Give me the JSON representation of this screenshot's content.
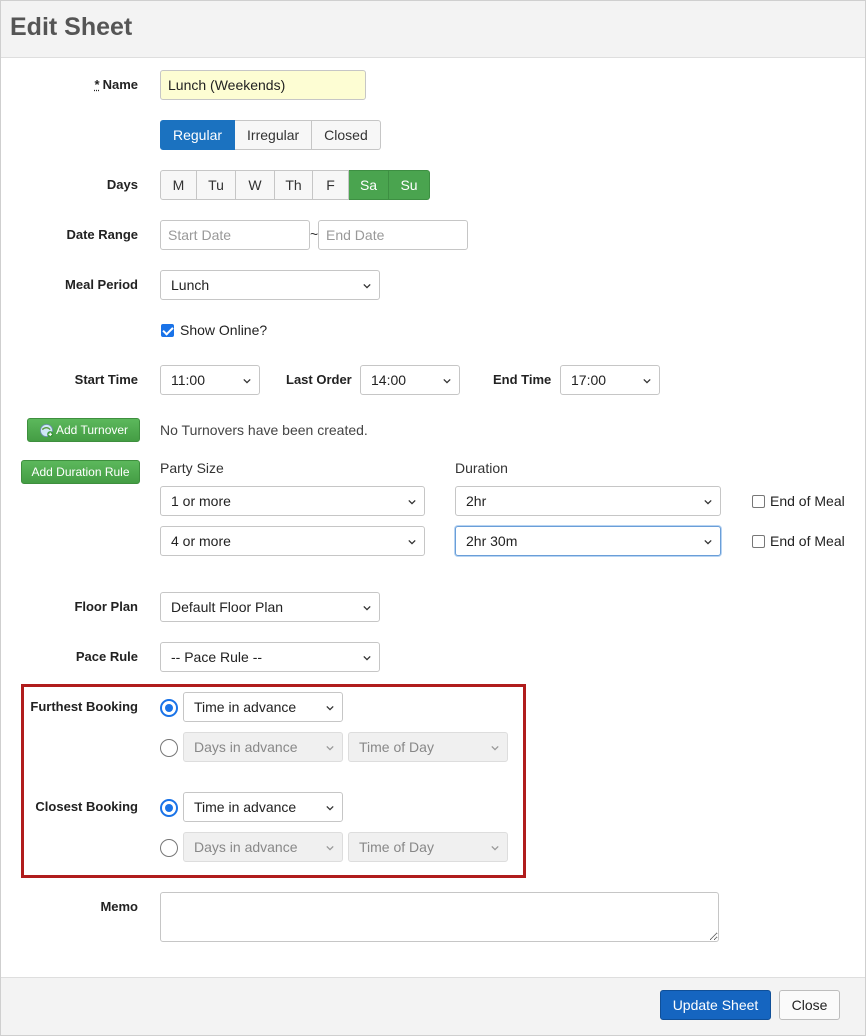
{
  "title": "Edit Sheet",
  "name": {
    "required_mark": "*",
    "label": "Name",
    "value": "Lunch (Weekends)"
  },
  "sheet_type": {
    "options": [
      "Regular",
      "Irregular",
      "Closed"
    ],
    "selected": "Regular"
  },
  "days": {
    "label": "Days",
    "options": [
      "M",
      "Tu",
      "W",
      "Th",
      "F",
      "Sa",
      "Su"
    ],
    "selected": [
      "Sa",
      "Su"
    ]
  },
  "date_range": {
    "label": "Date Range",
    "start_placeholder": "Start Date",
    "separator": "~",
    "end_placeholder": "End Date"
  },
  "meal_period": {
    "label": "Meal Period",
    "value": "Lunch"
  },
  "show_online": {
    "label": "Show Online?",
    "checked": true
  },
  "times": {
    "start_label": "Start Time",
    "start_value": "11:00",
    "last_order_label": "Last Order",
    "last_order_value": "14:00",
    "end_label": "End Time",
    "end_value": "17:00"
  },
  "turnover": {
    "button_label": "Add Turnover",
    "empty_text": "No Turnovers have been created."
  },
  "duration_rules": {
    "button_label": "Add Duration Rule",
    "party_size_header": "Party Size",
    "duration_header": "Duration",
    "rows": [
      {
        "party_size": "1 or more",
        "duration": "2hr",
        "end_of_meal_label": "End of Meal",
        "end_of_meal": false
      },
      {
        "party_size": "4 or more",
        "duration": "2hr 30m",
        "end_of_meal_label": "End of Meal",
        "end_of_meal": false
      }
    ]
  },
  "floor_plan": {
    "label": "Floor Plan",
    "value": "Default Floor Plan"
  },
  "pace_rule": {
    "label": "Pace Rule",
    "value": "-- Pace Rule --"
  },
  "furthest_booking": {
    "label": "Furthest Booking",
    "option1_value": "Time in advance",
    "option2_days": "Days in advance",
    "option2_time": "Time of Day",
    "selected": 1
  },
  "closest_booking": {
    "label": "Closest Booking",
    "option1_value": "Time in advance",
    "option2_days": "Days in advance",
    "option2_time": "Time of Day",
    "selected": 1
  },
  "memo": {
    "label": "Memo",
    "value": ""
  },
  "footer": {
    "update_label": "Update Sheet",
    "close_label": "Close"
  },
  "colors": {
    "primary": "#1565c0",
    "active_blue": "#1b72c0",
    "active_green": "#4aa44f",
    "highlight_border": "#b01c1c"
  }
}
